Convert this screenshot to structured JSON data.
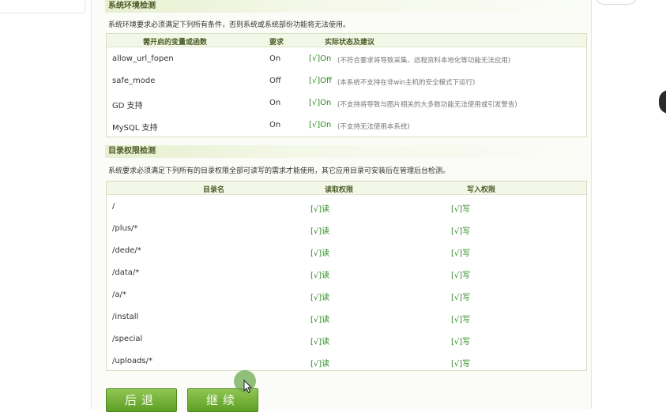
{
  "env_section": {
    "title": "系统环境检测",
    "desc": "系统环境要求必须满足下列所有条件，否则系统或系统部份功能将无法使用。",
    "headers": [
      "需开启的变量或函数",
      "要求",
      "实际状态及建议"
    ],
    "rows": [
      {
        "name": "allow_url_fopen",
        "required": "On",
        "status": "[√]On",
        "note": "(不符合要求将导致采集、远程资料本地化等功能无法应用)"
      },
      {
        "name": "safe_mode",
        "required": "Off",
        "status": "[√]Off",
        "note": "(本系统不支持在非win主机的安全模式下运行)"
      },
      {
        "name": "GD 支持",
        "required": "On",
        "status": "[√]On",
        "note": "(不支持将导致与图片相关的大多数功能无法使用或引发警告)"
      },
      {
        "name": "MySQL 支持",
        "required": "On",
        "status": "[√]On",
        "note": "(不支持无法使用本系统)"
      }
    ]
  },
  "dir_section": {
    "title": "目录权限检测",
    "desc": "系统要求必须满足下列所有的目录权限全部可读写的需求才能使用，其它应用目录可安装后在管理后台检测。",
    "headers": [
      "目录名",
      "读取权限",
      "写入权限"
    ],
    "rows": [
      {
        "dir": "/",
        "read": "[√]读",
        "write": "[√]写"
      },
      {
        "dir": "/plus/*",
        "read": "[√]读",
        "write": "[√]写"
      },
      {
        "dir": "/dede/*",
        "read": "[√]读",
        "write": "[√]写"
      },
      {
        "dir": "/data/*",
        "read": "[√]读",
        "write": "[√]写"
      },
      {
        "dir": "/a/*",
        "read": "[√]读",
        "write": "[√]写"
      },
      {
        "dir": "/install",
        "read": "[√]读",
        "write": "[√]写"
      },
      {
        "dir": "/special",
        "read": "[√]读",
        "write": "[√]写"
      },
      {
        "dir": "/uploads/*",
        "read": "[√]读",
        "write": "[√]写"
      }
    ]
  },
  "buttons": {
    "back": "后退",
    "next": "继续"
  },
  "colors": {
    "accent": "#6aa52e",
    "ok": "#2b8a1e",
    "header_text": "#4a5d27"
  }
}
